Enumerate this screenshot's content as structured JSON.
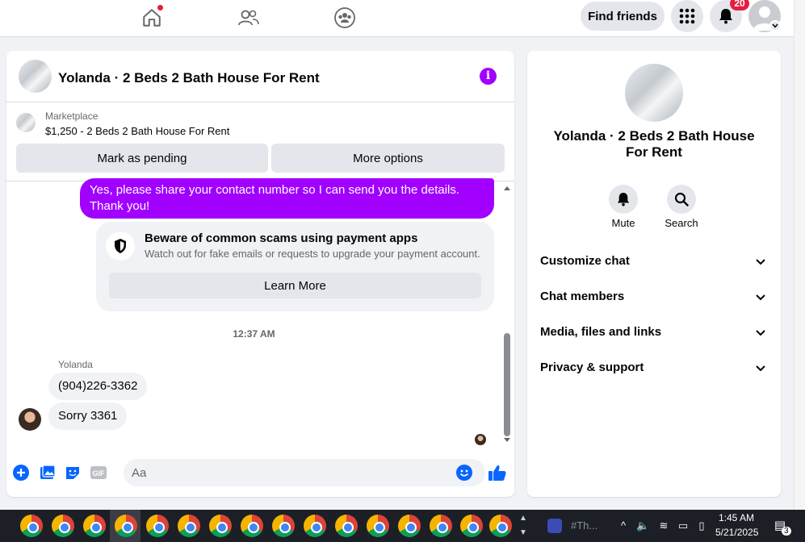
{
  "topbar": {
    "find_friends": "Find friends",
    "notifications_count": "20"
  },
  "chat": {
    "title": "Yolanda · 2 Beds 2 Bath House For Rent",
    "marketplace_label": "Marketplace",
    "listing_price": "$1,250 - 2 Beds 2 Bath House For Rent",
    "mark_pending": "Mark as pending",
    "more_options": "More options",
    "outgoing_message": "Yes, please share your contact number so I can send you the details. Thank you!",
    "scam_title": "Beware of common scams using payment apps",
    "scam_subtitle": "Watch out for fake emails or requests to upgrade your payment account.",
    "learn_more": "Learn More",
    "timestamp": "12:37 AM",
    "sender_name": "Yolanda",
    "incoming_messages": [
      "(904)226-3362",
      "Sorry 3361"
    ],
    "composer_placeholder": "Aa",
    "gif_label": "GIF"
  },
  "details": {
    "title": "Yolanda · 2 Beds 2 Bath House For Rent",
    "mute": "Mute",
    "search": "Search",
    "sections": [
      "Customize chat",
      "Chat members",
      "Media, files and links",
      "Privacy & support"
    ]
  },
  "taskbar": {
    "media_label": "#Th...",
    "time": "1:45 AM",
    "date": "5/21/2025",
    "notif_count": "3"
  },
  "colors": {
    "accent_purple": "#a100ff",
    "brand_blue": "#0866ff",
    "badge_red": "#e41e3f"
  }
}
